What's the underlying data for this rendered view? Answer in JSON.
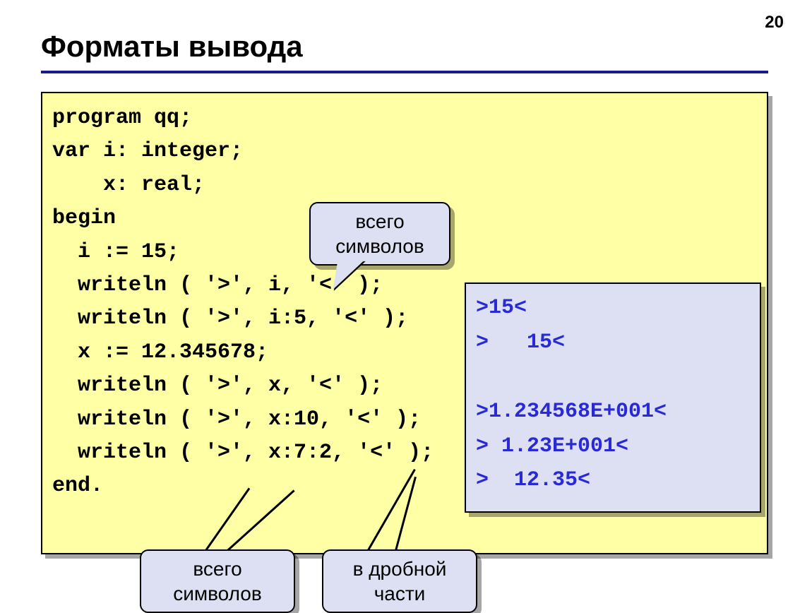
{
  "page_number": "20",
  "title": "Форматы вывода",
  "code": "program qq;\nvar i: integer;\n    x: real;\nbegin\n  i := 15;\n  writeln ( '>', i, '<' );\n  writeln ( '>', i:5, '<' );\n  x := 12.345678;\n  writeln ( '>', x, '<' );\n  writeln ( '>', x:10, '<' );\n  writeln ( '>', x:7:2, '<' );\nend.",
  "output": ">15<\n>   15<\n\n>1.234568E+001<\n> 1.23E+001<\n>  12.35<",
  "callouts": {
    "top": "всего\nсимволов",
    "bottom_left": "всего\nсимволов",
    "bottom_right": "в дробной\nчасти"
  }
}
